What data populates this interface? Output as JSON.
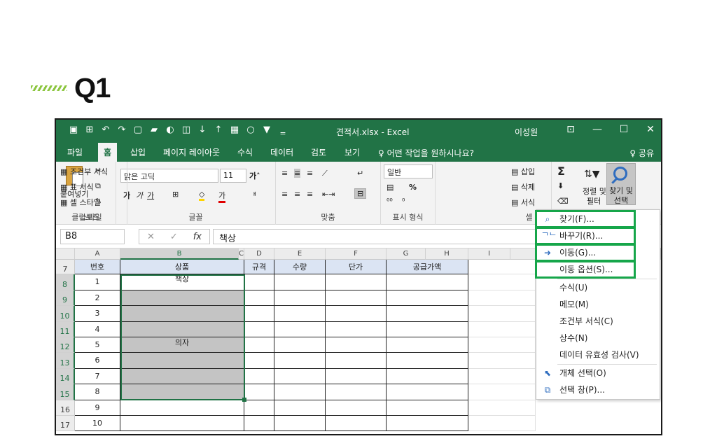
{
  "page": {
    "heading": "Q1"
  },
  "window": {
    "title": "견적서.xlsx  -  Excel",
    "user": "이성원",
    "controls": [
      "⊡",
      "—",
      "☐",
      "✕"
    ]
  },
  "tabs": [
    "파일",
    "홈",
    "삽입",
    "페이지 레이아웃",
    "수식",
    "데이터",
    "검토",
    "보기"
  ],
  "tell_me": "♀ 어떤 작업을 원하시나요?",
  "share": "♀ 공유",
  "ribbon": {
    "clipboard": {
      "label": "클립보드",
      "paste": "붙여넣기"
    },
    "font": {
      "label": "글꼴",
      "name": "맑은 고딕",
      "size": "11",
      "bold": "가",
      "italic": "가",
      "underline": "가"
    },
    "align": {
      "label": "맞춤"
    },
    "number": {
      "label": "표시 형식",
      "format": "일반",
      "percent": "%"
    },
    "styles": {
      "label": "스타일",
      "cond": "조건부 서식",
      "table": "표 서식",
      "cell": "셀 스타일"
    },
    "cells": {
      "label": "셀",
      "insert": "삽입",
      "delete": "삭제",
      "format": "서식"
    },
    "editing": {
      "sort": "정렬 및",
      "filter": "필터",
      "find": "찾기 및",
      "select": "선택"
    }
  },
  "formula_bar": {
    "name_box": "B8",
    "fx": "fx",
    "value": "책상"
  },
  "sheet": {
    "columns": [
      "A",
      "B",
      "C",
      "D",
      "E",
      "F",
      "G",
      "H",
      "I"
    ],
    "rows": [
      "7",
      "8",
      "9",
      "10",
      "11",
      "12",
      "13",
      "14",
      "15",
      "16",
      "17"
    ],
    "headers": [
      "번호",
      "상품",
      "규격",
      "수량",
      "단가",
      "공급가액"
    ],
    "numbers": [
      "1",
      "2",
      "3",
      "4",
      "5",
      "6",
      "7",
      "8",
      "9",
      "10"
    ],
    "b8": "책상",
    "b12": "의자"
  },
  "menu": {
    "items": [
      {
        "label": "찾기(F)...",
        "icon": "find-icon"
      },
      {
        "label": "바꾸기(R)...",
        "icon": "replace-icon"
      },
      {
        "label": "이동(G)...",
        "icon": "goto-icon"
      },
      {
        "label": "이동 옵션(S)...",
        "icon": ""
      },
      {
        "label": "수식(U)",
        "icon": ""
      },
      {
        "label": "메모(M)",
        "icon": ""
      },
      {
        "label": "조건부 서식(C)",
        "icon": ""
      },
      {
        "label": "상수(N)",
        "icon": ""
      },
      {
        "label": "데이터 유효성 검사(V)",
        "icon": ""
      },
      {
        "label": "개체 선택(O)",
        "icon": "select-objects-icon"
      },
      {
        "label": "선택 창(P)...",
        "icon": "selection-pane-icon"
      }
    ],
    "highlighted": [
      0,
      1,
      2,
      3
    ]
  },
  "colors": {
    "excel_green": "#217346",
    "highlight": "#16a64a",
    "header_fill": "#dbe4f3"
  }
}
